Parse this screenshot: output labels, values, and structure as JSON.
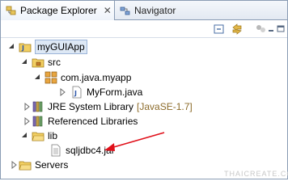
{
  "tabs": {
    "active_label": "Package Explorer",
    "active_close": "✕",
    "inactive_label": "Navigator"
  },
  "tree": {
    "project": "myGUIApp",
    "src": "src",
    "package": "com.java.myapp",
    "file": "MyForm.java",
    "jre_label": "JRE System Library",
    "jre_decor": "[JavaSE-1.7]",
    "referenced": "Referenced Libraries",
    "lib": "lib",
    "jar": "sqljdbc4.jar",
    "servers": "Servers"
  },
  "watermark": "THAICREATE.COM",
  "colors": {
    "selection": "#dde8f5",
    "arrow": "#e0101a",
    "decoration": "#8c6b2a"
  },
  "icons": [
    "package-explorer-icon",
    "navigator-icon",
    "collapse-all-icon",
    "link-with-editor-icon",
    "view-menu-icon",
    "minimize-icon",
    "maximize-icon",
    "project-icon",
    "source-folder-icon",
    "package-icon",
    "java-file-icon",
    "library-icon",
    "folder-icon",
    "jar-file-icon",
    "servers-folder-icon"
  ]
}
